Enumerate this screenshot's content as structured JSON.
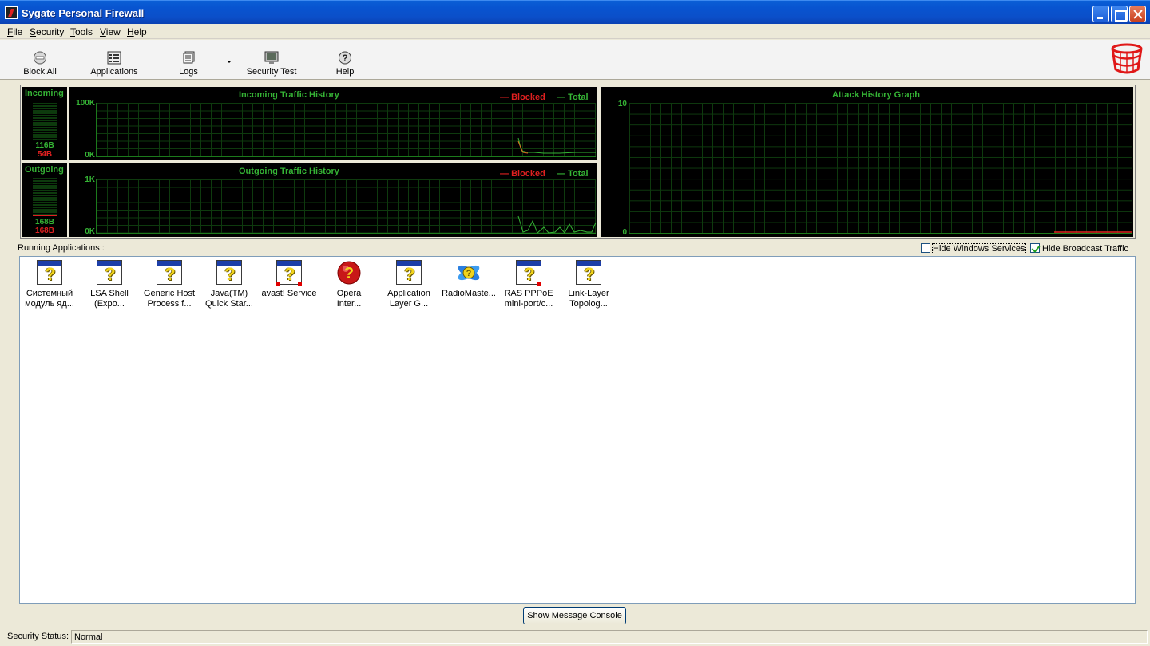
{
  "window": {
    "title": "Sygate Personal Firewall"
  },
  "menu": [
    "File",
    "Security",
    "Tools",
    "View",
    "Help"
  ],
  "toolbar": {
    "block_all": "Block All",
    "applications": "Applications",
    "logs": "Logs",
    "security_test": "Security Test",
    "help": "Help"
  },
  "incoming": {
    "meter_label": "Incoming",
    "total_value": "116B",
    "blocked_value": "54B",
    "graph_title": "Incoming Traffic History",
    "y_max": "100K",
    "y_min": "0K",
    "legend_blocked": "Blocked",
    "legend_total": "Total"
  },
  "outgoing": {
    "meter_label": "Outgoing",
    "total_value": "168B",
    "blocked_value": "168B",
    "graph_title": "Outgoing Traffic History",
    "y_max": "1K",
    "y_min": "0K",
    "legend_blocked": "Blocked",
    "legend_total": "Total"
  },
  "attack": {
    "graph_title": "Attack History Graph",
    "y_max": "10",
    "y_min": "0"
  },
  "colors": {
    "blocked": "#e02020",
    "total": "#35b335",
    "grid": "#0e3a0e"
  },
  "running": {
    "label": "Running Applications :",
    "hide_windows_services": {
      "label": "Hide Windows Services",
      "checked": false
    },
    "hide_broadcast_traffic": {
      "label": "Hide Broadcast Traffic",
      "checked": true
    },
    "apps": [
      {
        "name1": "Системный",
        "name2": "модуль яд...",
        "icon": "unknown-app-icon"
      },
      {
        "name1": "LSA Shell",
        "name2": "(Expo...",
        "icon": "unknown-app-icon"
      },
      {
        "name1": "Generic Host",
        "name2": "Process f...",
        "icon": "unknown-app-icon"
      },
      {
        "name1": "Java(TM)",
        "name2": "Quick Star...",
        "icon": "unknown-app-icon"
      },
      {
        "name1": "avast! Service",
        "name2": "",
        "icon": "unknown-app-icon"
      },
      {
        "name1": "Opera",
        "name2": "Inter...",
        "icon": "opera-icon"
      },
      {
        "name1": "Application",
        "name2": "Layer G...",
        "icon": "unknown-app-icon"
      },
      {
        "name1": "RadioMaste...",
        "name2": "",
        "icon": "radiomaster-icon"
      },
      {
        "name1": "RAS PPPoE",
        "name2": "mini-port/c...",
        "icon": "unknown-app-icon"
      },
      {
        "name1": "Link-Layer",
        "name2": "Topolog...",
        "icon": "unknown-app-icon"
      }
    ]
  },
  "console_button": "Show Message Console",
  "status": {
    "label": "Security Status:",
    "value": "Normal"
  }
}
